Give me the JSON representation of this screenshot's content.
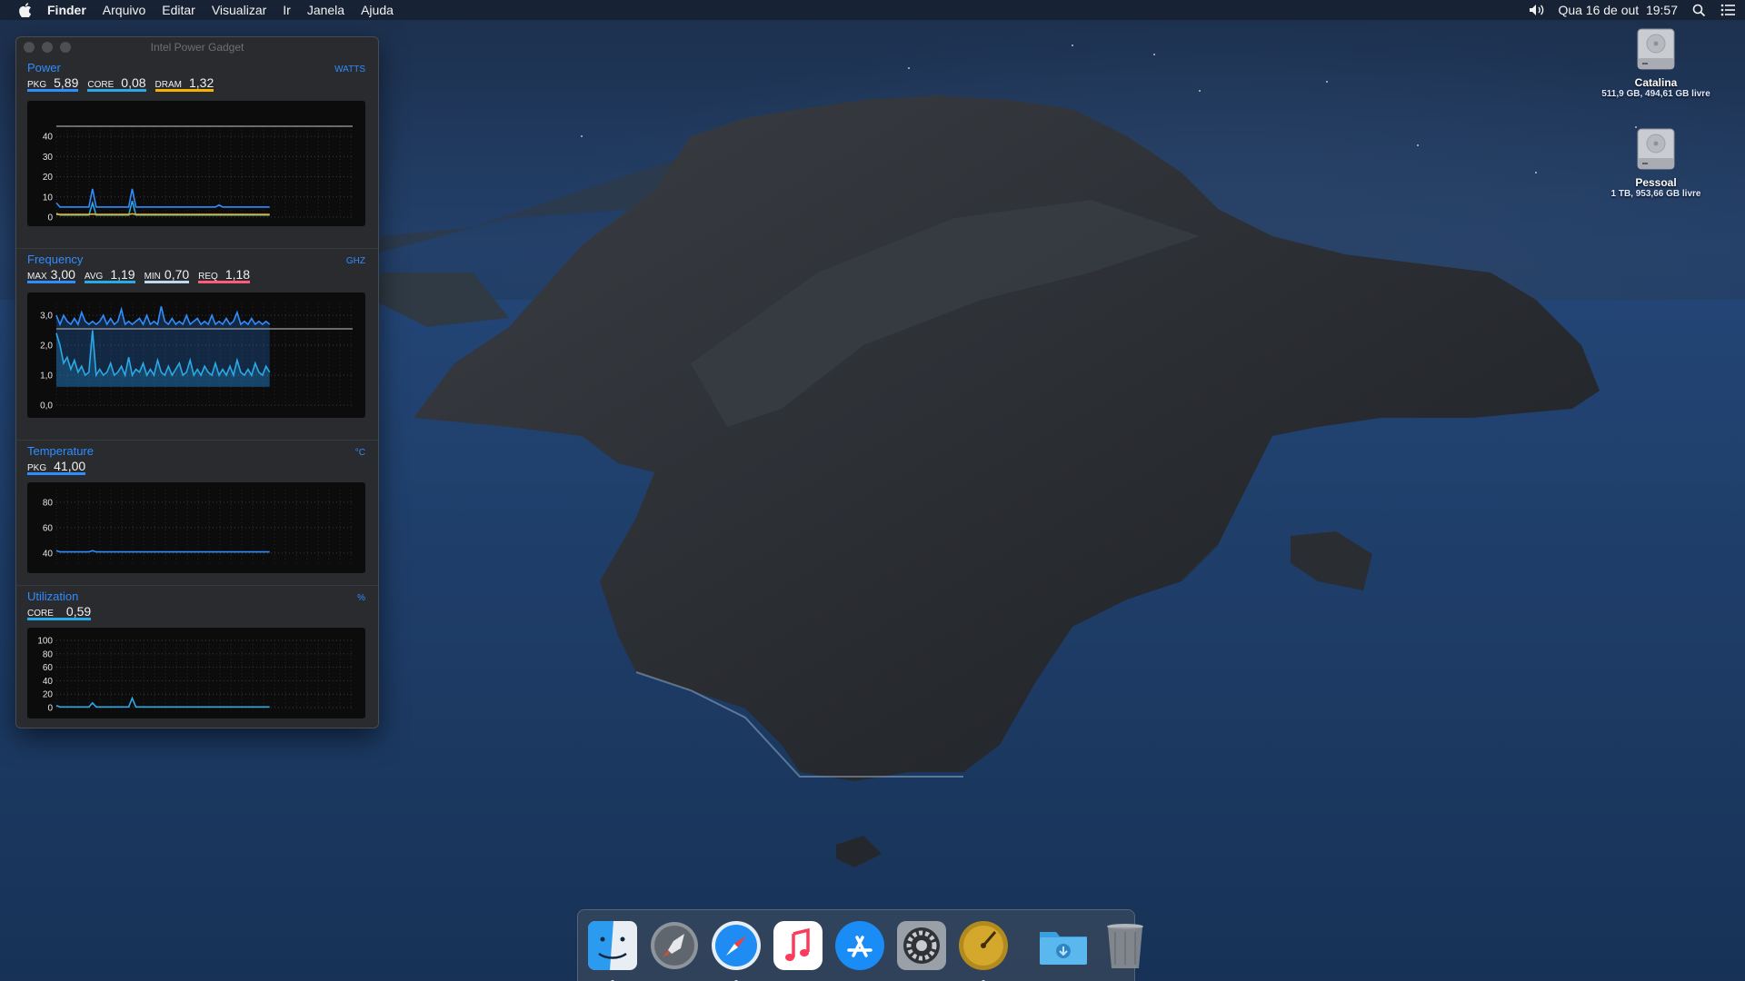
{
  "menubar": {
    "apple_icon": "apple-logo-icon",
    "app_name": "Finder",
    "menus": [
      "Arquivo",
      "Editar",
      "Visualizar",
      "Ir",
      "Janela",
      "Ajuda"
    ],
    "datetime": "Qua 16 de out  19:57",
    "status_icons": [
      "volume-icon",
      "spotlight-search-icon",
      "notification-center-icon"
    ]
  },
  "gadget": {
    "window_title": "Intel Power Gadget",
    "power": {
      "title": "Power",
      "unit": "WATTS",
      "readouts": [
        {
          "label": "PKG",
          "value": "5,89",
          "color": "#2e8dff"
        },
        {
          "label": "CORE",
          "value": "0,08",
          "color": "#2aa9e8"
        },
        {
          "label": "DRAM",
          "value": "1,32",
          "color": "#f5b300"
        }
      ],
      "y_ticks": [
        "40",
        "30",
        "20",
        "10",
        "0"
      ]
    },
    "frequency": {
      "title": "Frequency",
      "unit": "GHZ",
      "readouts": [
        {
          "label": "MAX",
          "value": "3,00",
          "color": "#2e8dff"
        },
        {
          "label": "AVG",
          "value": "1,19",
          "color": "#2aa9e8"
        },
        {
          "label": "MIN",
          "value": "0,70",
          "color": "#bcd9f0"
        },
        {
          "label": "REQ",
          "value": "1,18",
          "color": "#ff5a7a"
        }
      ],
      "y_ticks": [
        "3,0",
        "2,0",
        "1,0",
        "0,0"
      ]
    },
    "temperature": {
      "title": "Temperature",
      "unit": "°C",
      "readouts": [
        {
          "label": "PKG",
          "value": "41,00",
          "color": "#2e8dff"
        }
      ],
      "y_ticks": [
        "80",
        "60",
        "40"
      ]
    },
    "utilization": {
      "title": "Utilization",
      "unit": "%",
      "readouts": [
        {
          "label": "CORE",
          "value": "0,59",
          "color": "#2aa9e8"
        }
      ],
      "y_ticks": [
        "100",
        "80",
        "60",
        "40",
        "20",
        "0"
      ]
    }
  },
  "desktop": {
    "disks": [
      {
        "name": "Catalina",
        "info": "511,9 GB, 494,61 GB livre",
        "icon": "hard-drive-icon"
      },
      {
        "name": "Pessoal",
        "info": "1 TB, 953,66 GB livre",
        "icon": "hard-drive-icon"
      }
    ]
  },
  "dock": {
    "apps": [
      {
        "name": "finder-icon",
        "running": true
      },
      {
        "name": "launchpad-icon",
        "running": false
      },
      {
        "name": "safari-icon",
        "running": true
      },
      {
        "name": "music-icon",
        "running": false
      },
      {
        "name": "app-store-icon",
        "running": false
      },
      {
        "name": "system-preferences-icon",
        "running": false
      },
      {
        "name": "power-gadget-icon",
        "running": true
      }
    ],
    "extras": [
      "downloads-folder-icon",
      "trash-icon"
    ]
  },
  "chart_data": [
    {
      "type": "line",
      "y_range": [
        0,
        45
      ],
      "y_ticks": [
        0,
        10,
        20,
        30,
        40
      ],
      "series": [
        {
          "name": "PKG",
          "color": "#2e8dff",
          "values": [
            7,
            5,
            5,
            5,
            5,
            5,
            5,
            5,
            5,
            5,
            14,
            5,
            5,
            5,
            5,
            5,
            5,
            5,
            5,
            5,
            5,
            14,
            5,
            5,
            5,
            5,
            5,
            5,
            5,
            5,
            5,
            5,
            5,
            5,
            5,
            5,
            5,
            5,
            5,
            5,
            5,
            5,
            5,
            5,
            5,
            6,
            5,
            5,
            5,
            5,
            5,
            5,
            5,
            5,
            5,
            5,
            5,
            5,
            5,
            5
          ]
        },
        {
          "name": "CORE",
          "color": "#2aa9e8",
          "values": [
            2,
            1,
            1,
            1,
            1,
            1,
            1,
            1,
            1,
            1,
            7,
            1,
            1,
            1,
            1,
            1,
            1,
            1,
            1,
            1,
            1,
            8,
            1,
            1,
            1,
            1,
            1,
            1,
            1,
            1,
            1,
            1,
            1,
            1,
            1,
            1,
            1,
            1,
            1,
            1,
            1,
            1,
            1,
            1,
            1,
            1,
            1,
            1,
            1,
            1,
            1,
            1,
            1,
            1,
            1,
            1,
            1,
            1,
            1,
            1
          ]
        },
        {
          "name": "DRAM",
          "color": "#f5b300",
          "values": [
            1.3,
            1.3,
            1.3,
            1.3,
            1.3,
            1.3,
            1.3,
            1.3,
            1.3,
            1.3,
            1.5,
            1.3,
            1.3,
            1.3,
            1.3,
            1.3,
            1.3,
            1.3,
            1.3,
            1.3,
            1.3,
            1.6,
            1.3,
            1.3,
            1.3,
            1.3,
            1.3,
            1.3,
            1.3,
            1.3,
            1.3,
            1.3,
            1.3,
            1.3,
            1.3,
            1.3,
            1.3,
            1.3,
            1.3,
            1.3,
            1.3,
            1.3,
            1.3,
            1.3,
            1.3,
            1.3,
            1.3,
            1.3,
            1.3,
            1.3,
            1.3,
            1.3,
            1.3,
            1.3,
            1.3,
            1.3,
            1.3,
            1.3,
            1.3,
            1.3
          ]
        }
      ]
    },
    {
      "type": "area",
      "y_range": [
        0,
        3.4
      ],
      "y_ticks": [
        0,
        1,
        2,
        3
      ],
      "series": [
        {
          "name": "MAX",
          "color": "#2e8dff",
          "values": [
            3.0,
            2.7,
            3.0,
            2.8,
            2.7,
            2.9,
            2.7,
            3.1,
            2.8,
            2.7,
            2.8,
            2.7,
            2.8,
            3.0,
            2.7,
            2.9,
            2.7,
            2.8,
            3.2,
            2.7,
            2.8,
            2.7,
            2.8,
            2.9,
            2.7,
            3.0,
            2.7,
            2.8,
            2.7,
            3.3,
            2.8,
            2.7,
            2.9,
            2.7,
            2.8,
            2.7,
            3.0,
            2.7,
            2.8,
            2.9,
            2.7,
            2.8,
            2.7,
            3.0,
            2.7,
            2.8,
            2.7,
            2.9,
            2.7,
            2.8,
            3.1,
            2.7,
            2.8,
            2.7,
            2.9,
            2.7,
            2.8,
            2.7,
            2.8,
            2.7
          ]
        },
        {
          "name": "AVG",
          "color": "#2aa9e8",
          "values": [
            2.4,
            2.0,
            1.4,
            1.6,
            1.2,
            1.5,
            1.1,
            1.3,
            1.0,
            1.1,
            2.5,
            1.0,
            1.2,
            1.0,
            1.1,
            1.4,
            1.0,
            1.1,
            1.3,
            1.0,
            1.6,
            1.0,
            1.2,
            1.1,
            1.4,
            1.0,
            1.2,
            1.0,
            1.5,
            1.1,
            1.0,
            1.3,
            1.0,
            1.2,
            1.4,
            1.0,
            1.1,
            1.5,
            1.0,
            1.2,
            1.0,
            1.3,
            1.1,
            1.0,
            1.4,
            1.0,
            1.2,
            1.0,
            1.3,
            1.0,
            1.5,
            1.1,
            1.0,
            1.2,
            1.0,
            1.4,
            1.1,
            1.0,
            1.3,
            1.1
          ]
        },
        {
          "name": "REQ",
          "color": "#ff5a7a",
          "values": []
        }
      ]
    },
    {
      "type": "line",
      "y_range": [
        30,
        90
      ],
      "y_ticks": [
        40,
        60,
        80
      ],
      "series": [
        {
          "name": "PKG",
          "color": "#2e8dff",
          "values": [
            42,
            41,
            41,
            41,
            41,
            41,
            41,
            41,
            41,
            41,
            42,
            41,
            41,
            41,
            41,
            41,
            41,
            41,
            41,
            41,
            41,
            41,
            41,
            41,
            41,
            41,
            41,
            41,
            41,
            41,
            41,
            41,
            41,
            41,
            41,
            41,
            41,
            41,
            41,
            41,
            41,
            41,
            41,
            41,
            41,
            41,
            41,
            41,
            41,
            41,
            41,
            41,
            41,
            41,
            41,
            41,
            41,
            41,
            41,
            41
          ]
        }
      ]
    },
    {
      "type": "line",
      "y_range": [
        0,
        100
      ],
      "y_ticks": [
        0,
        20,
        40,
        60,
        80,
        100
      ],
      "series": [
        {
          "name": "CORE",
          "color": "#2aa9e8",
          "values": [
            3,
            1,
            1,
            1,
            1,
            1,
            1,
            1,
            1,
            1,
            7,
            1,
            1,
            1,
            1,
            1,
            1,
            1,
            1,
            1,
            1,
            14,
            1,
            1,
            1,
            1,
            1,
            1,
            1,
            1,
            1,
            1,
            1,
            1,
            1,
            1,
            1,
            1,
            1,
            1,
            1,
            1,
            1,
            1,
            1,
            1,
            1,
            1,
            1,
            1,
            1,
            1,
            1,
            1,
            1,
            1,
            1,
            1,
            1,
            1
          ]
        }
      ]
    }
  ]
}
